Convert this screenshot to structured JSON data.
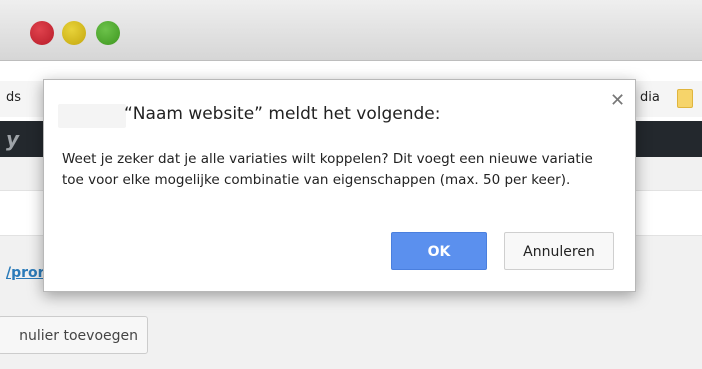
{
  "window": {
    "controls": [
      "close-button",
      "minimize-button",
      "zoom-button"
    ]
  },
  "bookmarks": {
    "left_text": "ds",
    "right_text": "dia"
  },
  "page": {
    "link_fragment": "/pror",
    "button_fragment": "nulier toevoegen"
  },
  "dialog": {
    "title": "“Naam website” meldt het volgende:",
    "message": "Weet je zeker dat je alle variaties wilt koppelen? Dit voegt een nieuwe variatie toe voor elke mogelijke combinatie van eigenschappen (max. 50 per keer).",
    "ok_label": "OK",
    "cancel_label": "Annuleren",
    "close_icon": "close-icon"
  },
  "colors": {
    "ok_button": "#5b90ee",
    "admin_bar": "#23282d",
    "link": "#2b7bb9"
  }
}
